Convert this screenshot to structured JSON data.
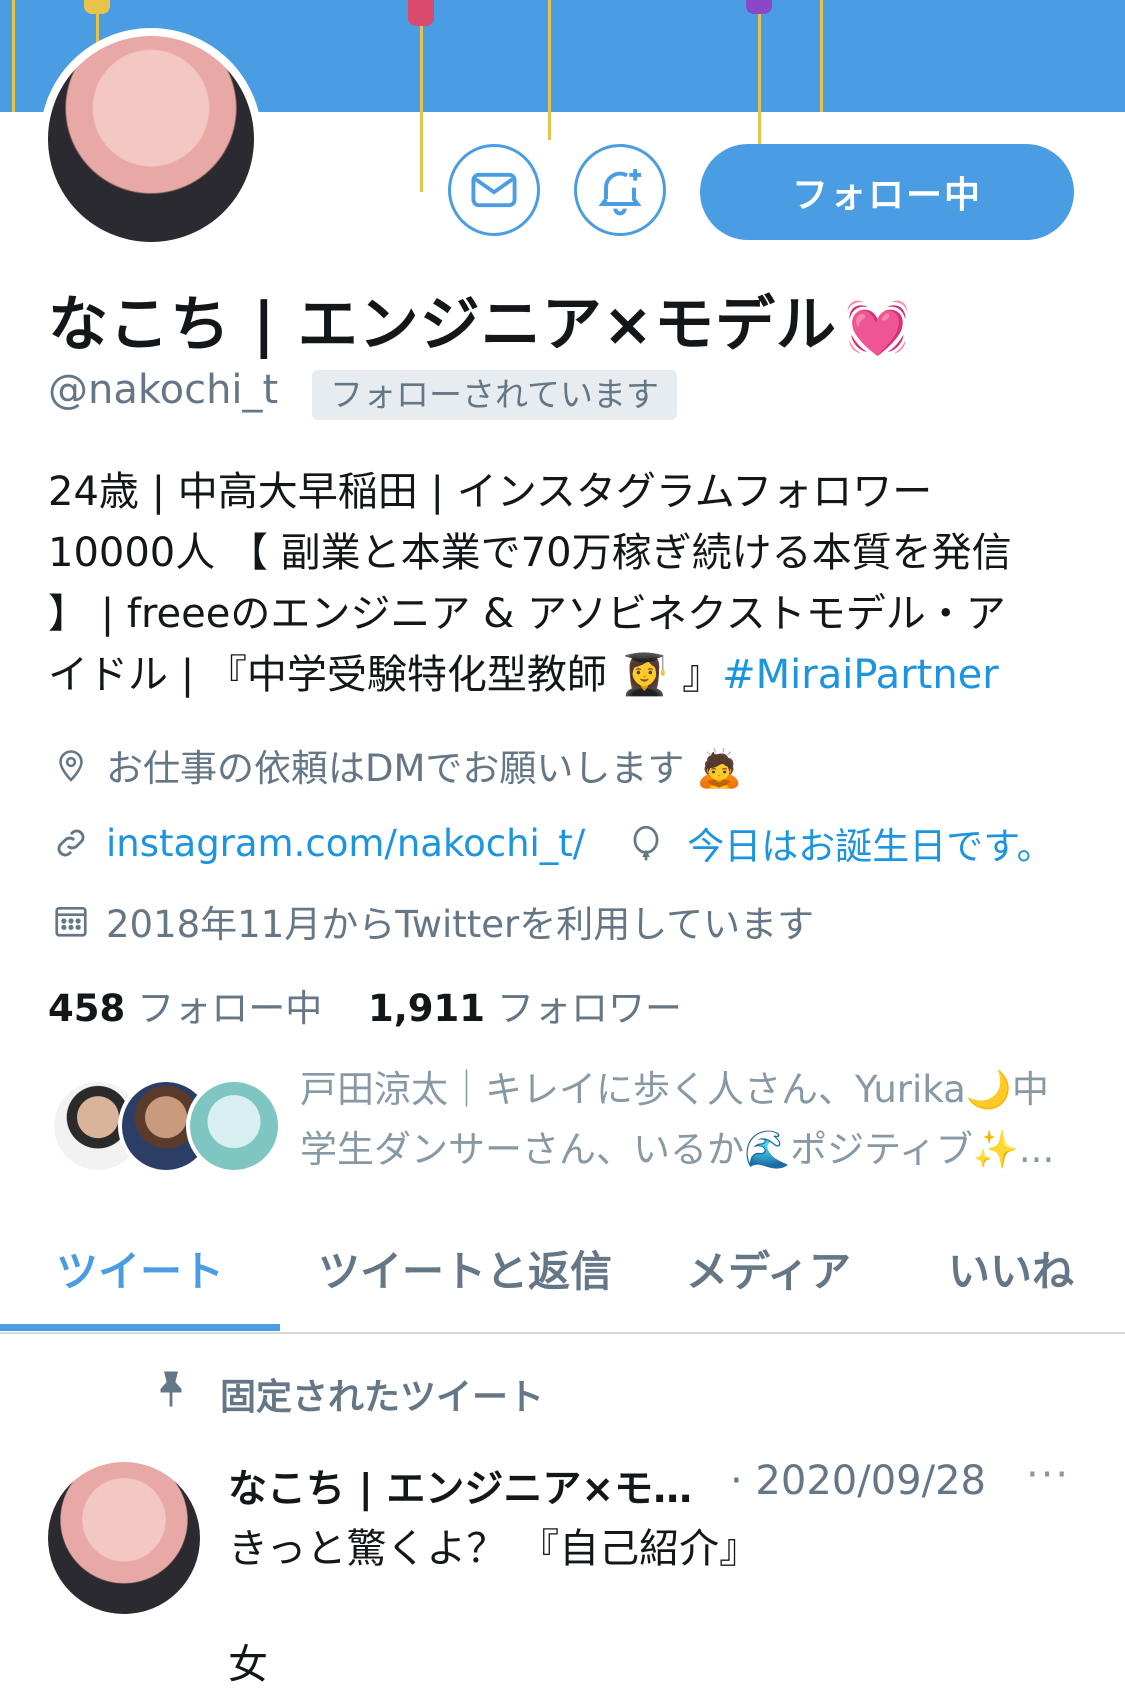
{
  "header": {
    "follow_button": "フォロー中",
    "message_icon": "mail-icon",
    "notify_icon": "bell-plus-icon"
  },
  "profile": {
    "name": "なこち | エンジニア×モデル",
    "name_emoji": "💓",
    "handle": "@nakochi_t",
    "follows_you": "フォローされています",
    "bio_lines": [
      "24歳 | 中高大早稲田 | インスタグラムフォロワー",
      "10000人 【 副業と本業で70万稼ぎ続ける本質を発信",
      "】 | freeeのエンジニア & アソビネクストモデル・ア",
      "イドル | 『中学受験特化型教師 👩‍🎓 』"
    ],
    "bio_hashtag": "#MiraiPartner",
    "location": "お仕事の依頼はDMでお願いします 🙇",
    "link": "instagram.com/nakochi_t/",
    "birthday": "今日はお誕生日です。",
    "joined": "2018年11月からTwitterを利用しています",
    "following_count": "458",
    "following_label": "フォロー中",
    "followers_count": "1,911",
    "followers_label": "フォロワー",
    "followed_by_line1": "戸田涼太｜キレイに歩く人さん、Yurika🌙中",
    "followed_by_line2": "学生ダンサーさん、いるか🌊ポジティブ✨..."
  },
  "tabs": [
    {
      "label": "ツイート"
    },
    {
      "label": "ツイートと返信"
    },
    {
      "label": "メディア"
    },
    {
      "label": "いいね"
    }
  ],
  "pinned_tweet": {
    "label": "固定されたツイート",
    "author": "なこち | エンジニア×モ…",
    "date": "· 2020/09/28",
    "more": "···",
    "text": "きっと驚くよ？ 『自己紹介』",
    "text2": "女"
  },
  "colors": {
    "accent": "#4a9de2",
    "link": "#1b95e0",
    "muted": "#657786"
  }
}
